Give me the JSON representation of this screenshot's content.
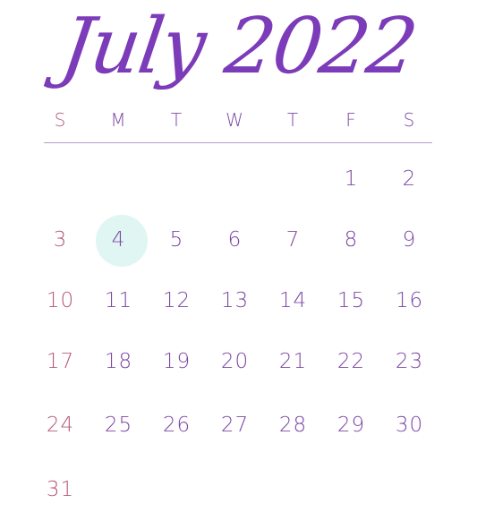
{
  "title": "July 2022",
  "colors": {
    "title": "#7c3bb8",
    "sunday": "#b55a7a",
    "weekday": "#7d48a6",
    "today_highlight": "#dff6f2",
    "divider": "#b79cc9"
  },
  "weekdays": [
    "S",
    "M",
    "T",
    "W",
    "T",
    "F",
    "S"
  ],
  "weeks": [
    [
      "",
      "",
      "",
      "",
      "",
      "1",
      "2"
    ],
    [
      "3",
      "4",
      "5",
      "6",
      "7",
      "8",
      "9"
    ],
    [
      "10",
      "11",
      "12",
      "13",
      "14",
      "15",
      "16"
    ],
    [
      "17",
      "18",
      "19",
      "20",
      "21",
      "22",
      "23"
    ],
    [
      "24",
      "25",
      "26",
      "27",
      "28",
      "29",
      "30"
    ],
    [
      "31",
      "",
      "",
      "",
      "",
      "",
      ""
    ]
  ],
  "highlighted_day": "4"
}
